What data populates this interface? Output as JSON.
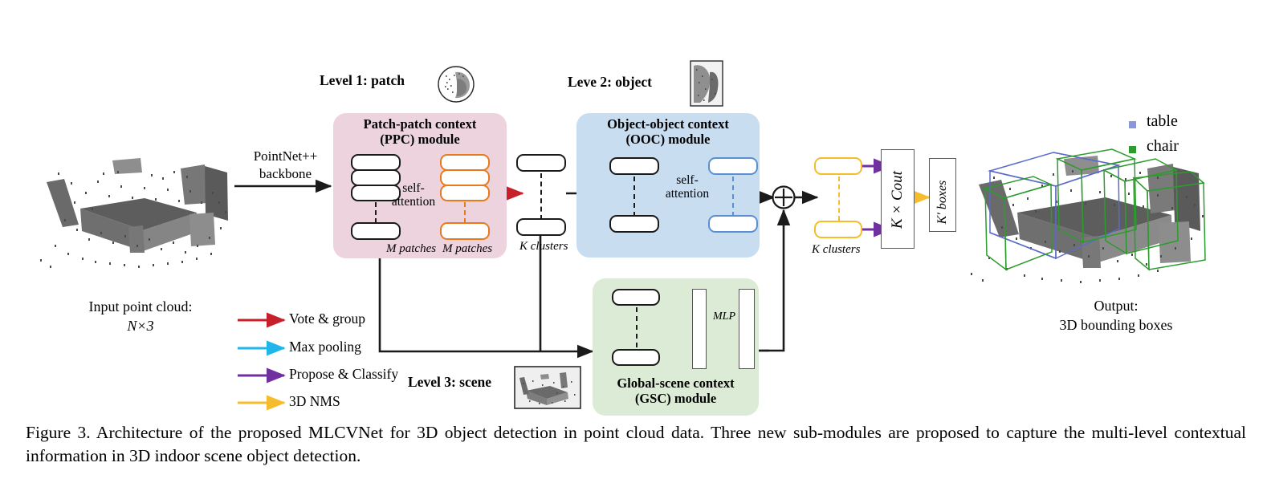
{
  "figure": {
    "caption": "Figure 3. Architecture of the proposed MLCVNet for 3D object detection in point cloud data.  Three new sub-modules are proposed to capture the multi-level contextual information in 3D indoor scene object detection."
  },
  "input": {
    "label_line1": "Input point cloud:",
    "label_line2": "N×3",
    "backbone_line1": "PointNet++",
    "backbone_line2": "backbone"
  },
  "levels": {
    "level1": "Level 1: patch",
    "level2": "Leve 2: object",
    "level3": "Level 3: scene"
  },
  "modules": {
    "ppc": {
      "title_line1": "Patch-patch context",
      "title_line2": "(PPC) module",
      "bg_color": "#EDD3DE",
      "accent_color": "#E8791E",
      "self_attention_line1": "self-",
      "self_attention_line2": "attention",
      "left_caption": "M patches",
      "right_caption": "M patches"
    },
    "ooc": {
      "title_line1": "Object-object context",
      "title_line2": "(OOC) module",
      "bg_color": "#C9DDF0",
      "accent_color": "#5A8FD0",
      "self_attention_line1": "self-",
      "self_attention_line2": "attention"
    },
    "gsc": {
      "title_line1": "Global-scene context",
      "title_line2": "(GSC) module",
      "bg_color": "#DCEBD5",
      "mlp_label": "MLP"
    }
  },
  "stages": {
    "k_clusters_mid": "K clusters",
    "k_clusters_right": "K clusters",
    "fusion_symbol": "⊕",
    "kcout_label": "K × Cout",
    "kboxes_label": "K′ boxes"
  },
  "legend": {
    "items": [
      {
        "label": "Vote & group",
        "color": "#C8202A"
      },
      {
        "label": "Max pooling",
        "color": "#21B6EA"
      },
      {
        "label": "Propose & Classify",
        "color": "#7030A0"
      },
      {
        "label": "3D NMS",
        "color": "#F5BC2B"
      }
    ]
  },
  "output": {
    "label_line1": "Output:",
    "label_line2": "3D bounding boxes",
    "classes": [
      {
        "name": "table",
        "color": "#8A97DB"
      },
      {
        "name": "chair",
        "color": "#2E9B2E"
      }
    ]
  }
}
